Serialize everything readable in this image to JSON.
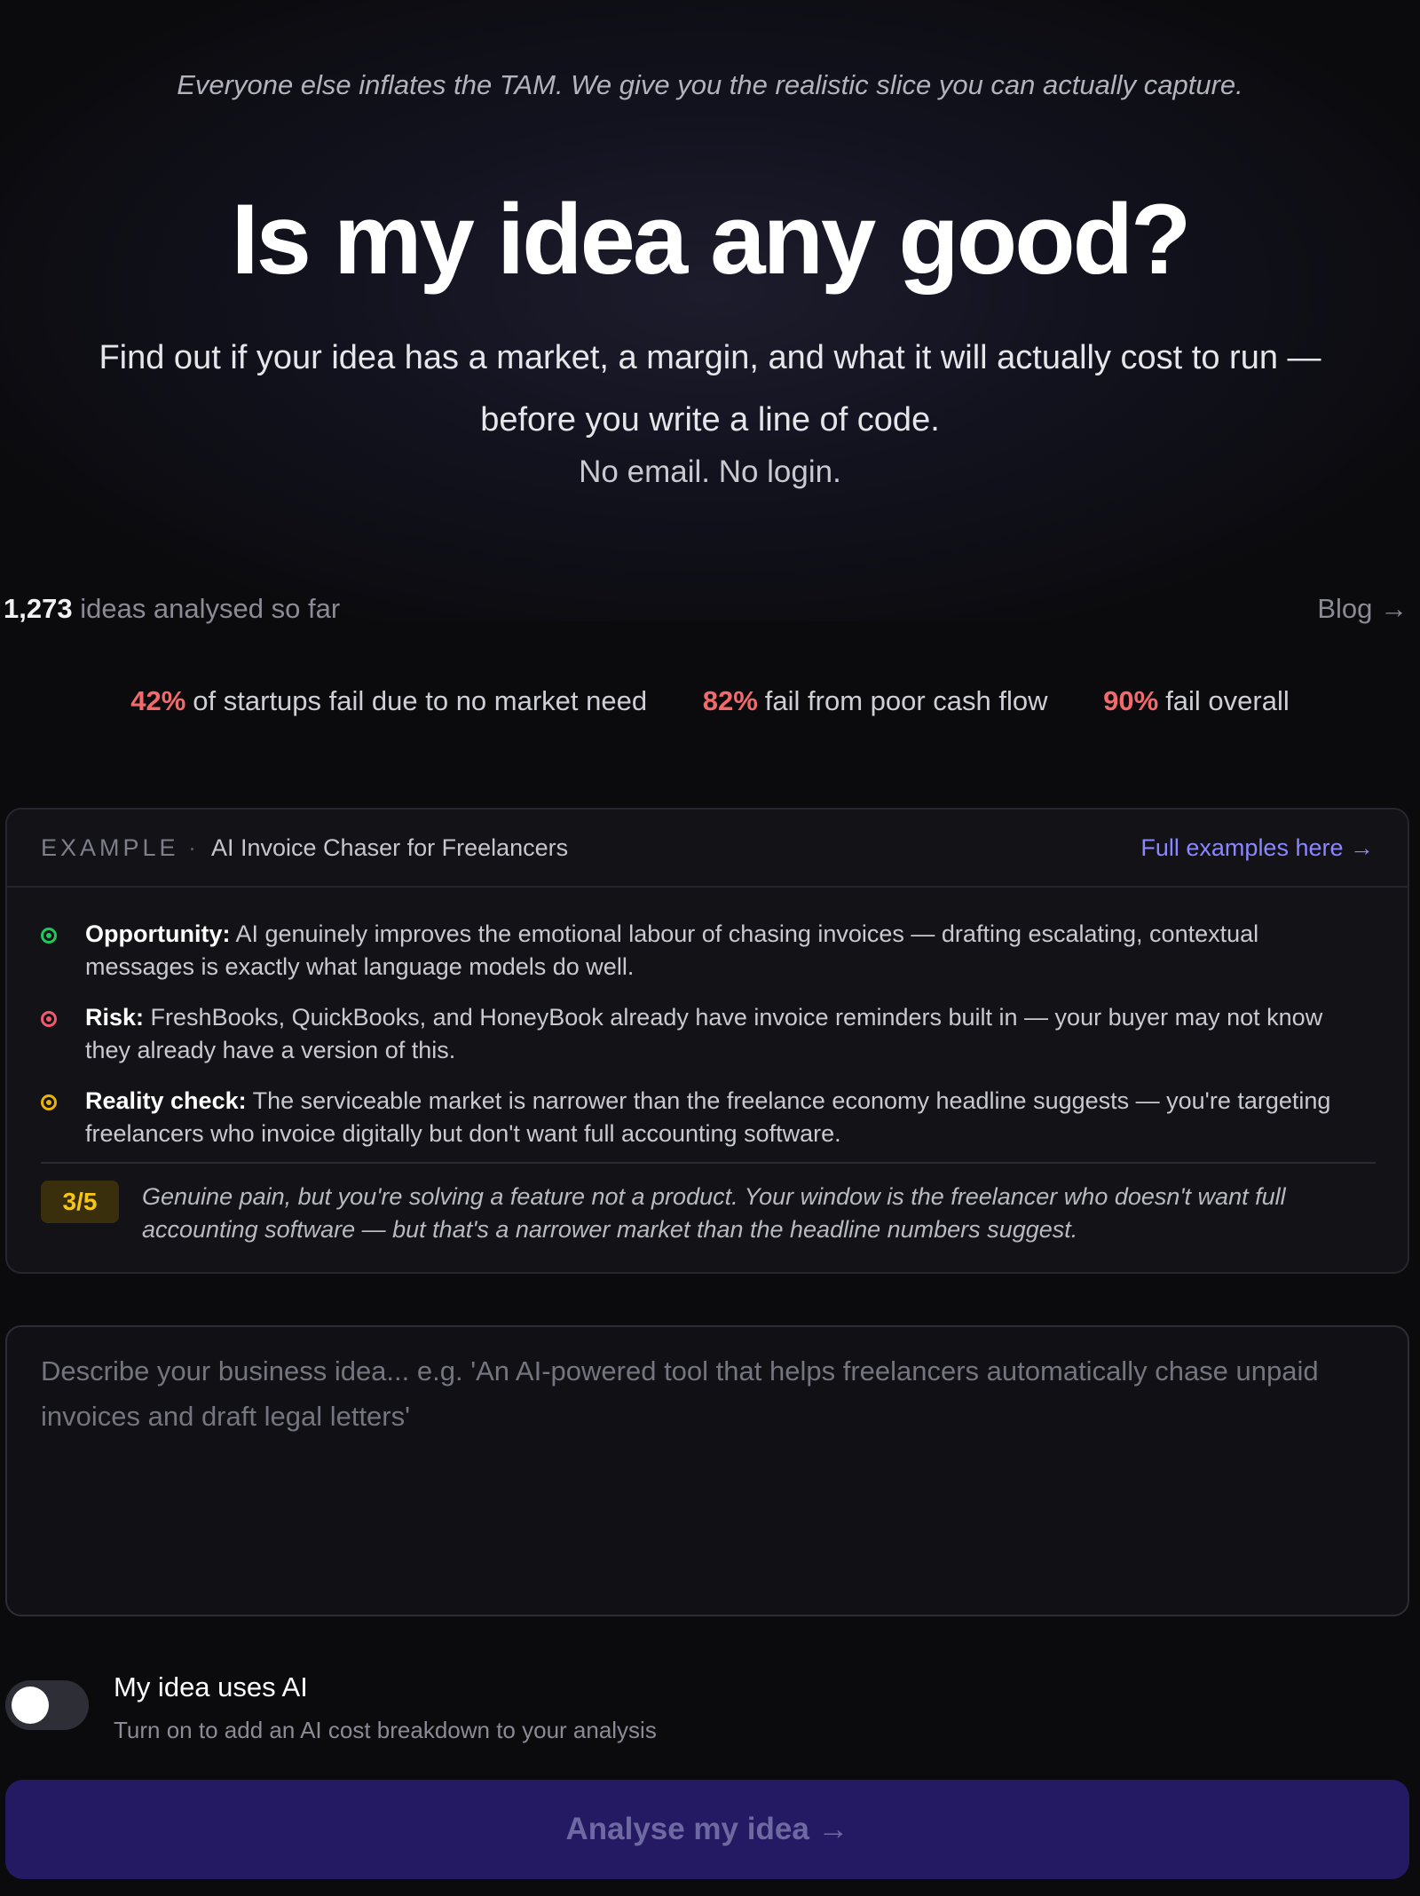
{
  "hero": {
    "tagline": "Everyone else inflates the TAM. We give you the realistic slice you can actually capture.",
    "title": "Is my idea any good?",
    "subtitle_line1": "Find out if your idea has a market, a margin, and what it will actually cost to run —",
    "subtitle_line2": "before you write a line of code.",
    "note": "No email. No login."
  },
  "counter": {
    "count": "1,273",
    "label": "ideas analysed so far"
  },
  "nav": {
    "blog_label": "Blog →"
  },
  "stats": [
    {
      "pct": "42%",
      "text": "of startups fail due to no market need"
    },
    {
      "pct": "82%",
      "text": "fail from poor cash flow"
    },
    {
      "pct": "90%",
      "text": "fail overall"
    }
  ],
  "example": {
    "label": "EXAMPLE",
    "separator": "·",
    "idea_name": "AI Invoice Chaser for Freelancers",
    "full_examples_link": "Full examples here →",
    "bullets": [
      {
        "icon": "opportunity-icon",
        "color": "#22c55e",
        "label": "Opportunity:",
        "text": "AI genuinely improves the emotional labour of chasing invoices — drafting escalating, contextual messages is exactly what language models do well."
      },
      {
        "icon": "risk-icon",
        "color": "#f05a6e",
        "label": "Risk:",
        "text": "FreshBooks, QuickBooks, and HoneyBook already have invoice reminders built in — your buyer may not know they already have a version of this."
      },
      {
        "icon": "reality-check-icon",
        "color": "#eab308",
        "label": "Reality check:",
        "text": "The serviceable market is narrower than the freelance economy headline suggests — you're targeting freelancers who invoice digitally but don't want full accounting software."
      }
    ],
    "score": "3/5",
    "verdict": "Genuine pain, but you're solving a feature not a product. Your window is the freelancer who doesn't want full accounting software — but that's a narrower market than the headline numbers suggest."
  },
  "form": {
    "idea_value": "",
    "idea_placeholder": "Describe your business idea... e.g. 'An AI-powered tool that helps freelancers automatically chase unpaid invoices and draft legal letters'",
    "ai_toggle_on": false,
    "ai_toggle_title": "My idea uses AI",
    "ai_toggle_desc": "Turn on to add an AI cost breakdown to your analysis",
    "submit_label": "Analyse my idea →"
  },
  "colors": {
    "background": "#0b0b0e",
    "stat_accent": "#f26a6a",
    "link_accent": "#8c86ff",
    "button_bg": "#231a63",
    "score_accent": "#f5c518"
  }
}
